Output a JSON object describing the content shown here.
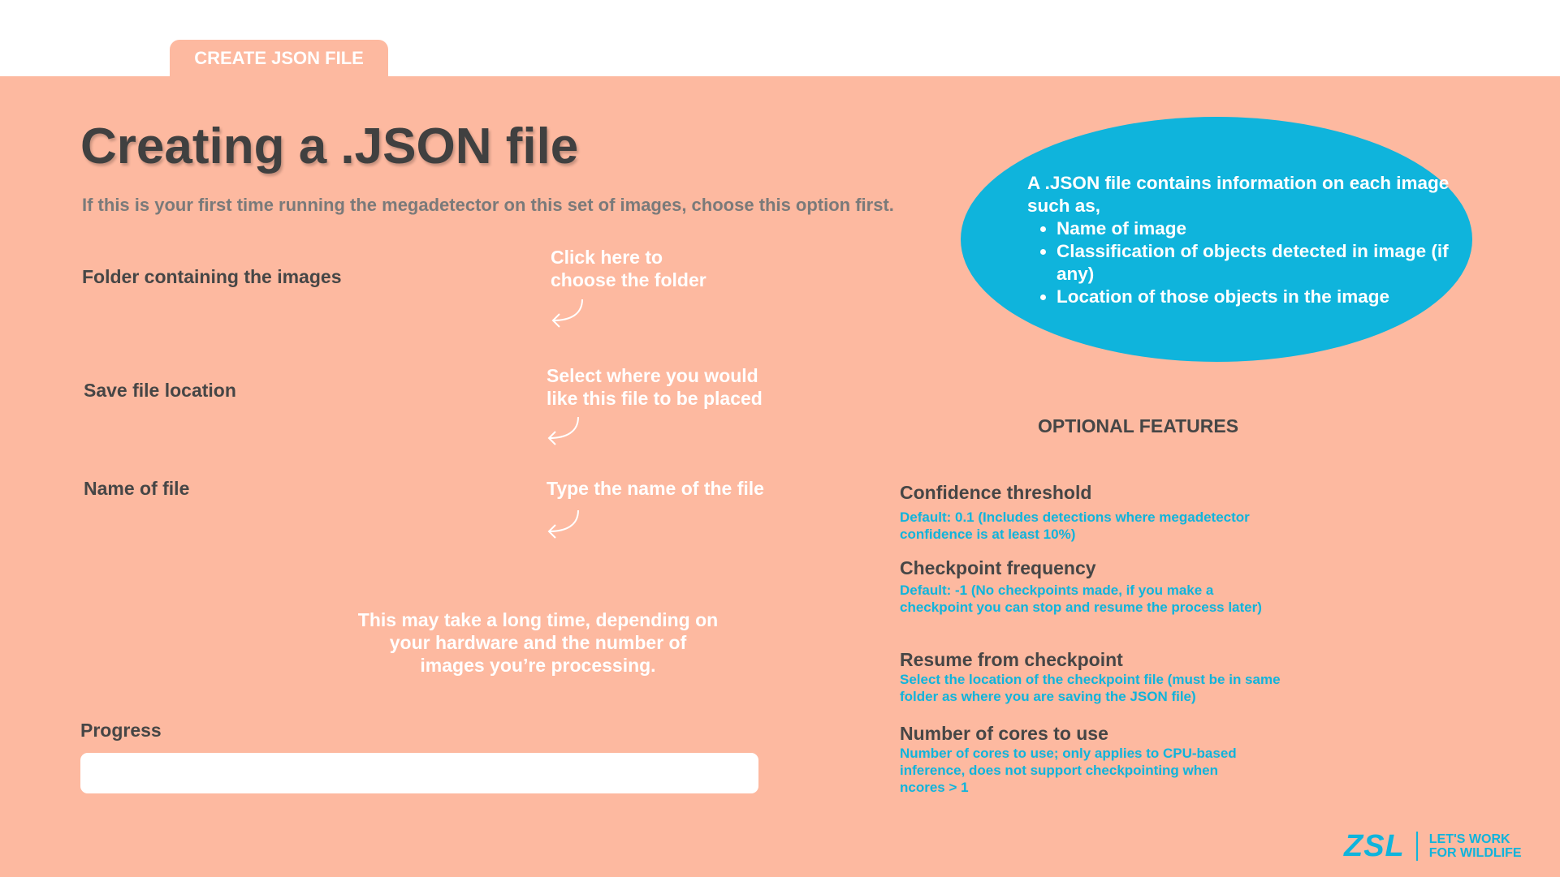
{
  "tab": {
    "label": "CREATE JSON FILE"
  },
  "page": {
    "title": "Creating a .JSON file",
    "subtitle": "If this is your first time running the megadetector on this set of images, choose this option first."
  },
  "fields": [
    {
      "label": "Folder containing the images",
      "hint": "Click here to\nchoose the folder"
    },
    {
      "label": "Save file location",
      "hint": "Select where you would\nlike this file to be placed"
    },
    {
      "label": "Name of file",
      "hint": "Type the name of the file"
    }
  ],
  "info_bubble": {
    "intro": "A .JSON file contains information on each image such as,",
    "bullets": [
      "Name of image",
      "Classification of objects detected in image (if any)",
      "Location of those objects in the image"
    ]
  },
  "optional": {
    "title": "OPTIONAL FEATURES",
    "items": [
      {
        "label": "Confidence threshold",
        "desc": "Default: 0.1 (Includes detections where megadetector confidence is at least 10%)"
      },
      {
        "label": "Checkpoint frequency",
        "desc": "Default: -1 (No checkpoints made, if you make a checkpoint you can stop and resume the process later)"
      },
      {
        "label": "Resume from checkpoint",
        "desc": "Select the location of the checkpoint file (must be in same folder as where you are saving the JSON file)"
      },
      {
        "label": "Number of cores to use",
        "desc": "Number of cores to use; only applies to CPU-based inference, does not support checkpointing when ncores > 1"
      }
    ]
  },
  "note": "This may take a long time, depending on your hardware and the number of images you’re processing.",
  "progress": {
    "label": "Progress",
    "value": 0
  },
  "logo": {
    "name": "ZSL",
    "tagline_1": "LET'S WORK",
    "tagline_2": "FOR WILDLIFE"
  },
  "colors": {
    "panel": "#fdb9a0",
    "accent": "#0fb4dc",
    "text": "#464646"
  }
}
